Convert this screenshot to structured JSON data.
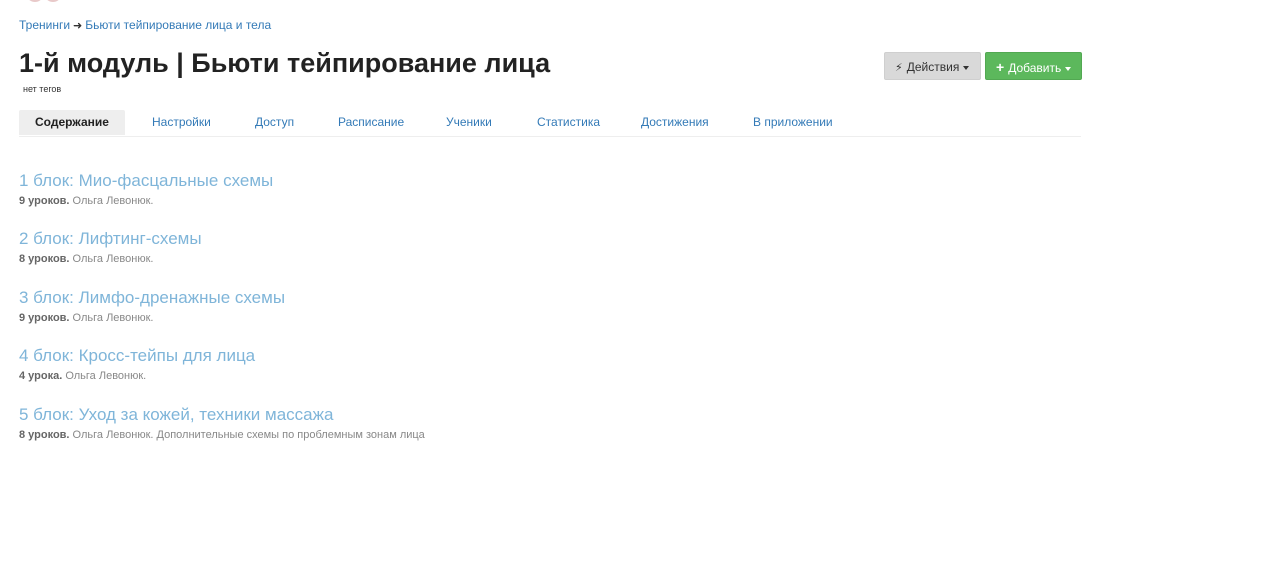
{
  "breadcrumb": {
    "parent": "Тренинги",
    "separator": "➜",
    "current": "Бьюти тейпирование лица и тела"
  },
  "header": {
    "title": "1-й модуль | Бьюти тейпирование лица",
    "tags": "нет тегов",
    "actions_label": "Действия",
    "add_label": "Добавить",
    "actions_icon": "bolt-icon",
    "add_icon": "plus-icon"
  },
  "tabs": [
    {
      "label": "Содержание",
      "active": true
    },
    {
      "label": "Настройки"
    },
    {
      "label": "Доступ"
    },
    {
      "label": "Расписание"
    },
    {
      "label": "Ученики"
    },
    {
      "label": "Статистика"
    },
    {
      "label": "Достижения"
    },
    {
      "label": "В приложении"
    }
  ],
  "lessons": [
    {
      "title": "1 блок: Мио-фасцальные схемы",
      "count": "9 уроков.",
      "info": "Ольга Левонюк."
    },
    {
      "title": "2 блок: Лифтинг-схемы",
      "count": "8 уроков.",
      "info": "Ольга Левонюк."
    },
    {
      "title": "3 блок: Лимфо-дренажные схемы",
      "count": "9 уроков.",
      "info": "Ольга Левонюк."
    },
    {
      "title": "4 блок: Кросс-тейпы для лица",
      "count": "4 урока.",
      "info": "Ольга Левонюк."
    },
    {
      "title": "5 блок: Уход за кожей, техники массажа",
      "count": "8 уроков.",
      "info": "Ольга Левонюк. Дополнительные схемы по проблемным зонам лица"
    }
  ],
  "colors": {
    "link": "#337ab7",
    "lesson_link": "#7fb5d9",
    "add_button": "#5cb85c",
    "actions_button": "#d9d9d9"
  }
}
